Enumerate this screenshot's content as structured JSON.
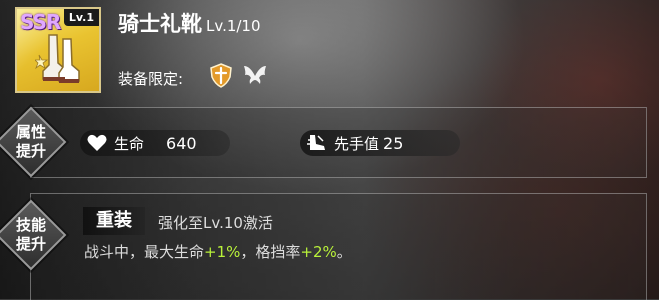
{
  "item": {
    "rarity": "SSR",
    "card_level": "Lv.1",
    "name": "骑士礼靴",
    "level": "Lv.1/10"
  },
  "equip_limit": {
    "label": "装备限定:",
    "icons": [
      "orange-shield-class-icon",
      "white-wings-class-icon"
    ]
  },
  "attribute_boost": {
    "badge_label": "属性\n提升",
    "stats": [
      {
        "icon": "heart-icon",
        "name": "生命",
        "value": "640"
      },
      {
        "icon": "initiative-boot-icon",
        "name": "先手值",
        "value": "25"
      }
    ]
  },
  "skill_boost": {
    "badge_label": "技能\n提升",
    "skill_name": "重装",
    "requirement": "强化至Lv.10激活",
    "description_parts": [
      "战斗中，最大生命",
      "+1%",
      "，格挡率",
      "+2%",
      "。"
    ]
  },
  "colors": {
    "highlight_green": "#b9f23a",
    "card_gold": "#e9c330"
  }
}
